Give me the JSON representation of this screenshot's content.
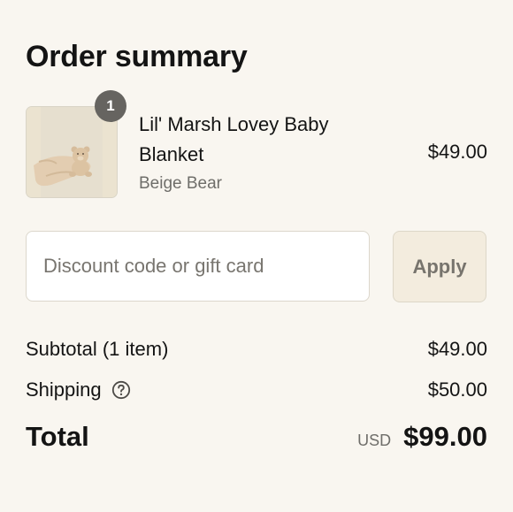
{
  "summary": {
    "title": "Order summary"
  },
  "line_item": {
    "quantity": "1",
    "name": "Lil' Marsh Lovey Baby Blanket",
    "variant": "Beige Bear",
    "price": "$49.00",
    "image_icon": "product-photo-teddy-bear-blanket"
  },
  "discount": {
    "placeholder": "Discount code or gift card",
    "value": "",
    "apply_label": "Apply"
  },
  "totals": {
    "subtotal_label": "Subtotal (1 item)",
    "subtotal_value": "$49.00",
    "shipping_label": "Shipping",
    "shipping_value": "$50.00",
    "shipping_help_icon": "question-circle-icon",
    "total_label": "Total",
    "currency": "USD",
    "total_value": "$99.00"
  },
  "colors": {
    "background": "#f9f6f0",
    "apply_button_bg": "#f3ecde",
    "badge_bg": "#666460",
    "muted_text": "#6f6e6a"
  }
}
